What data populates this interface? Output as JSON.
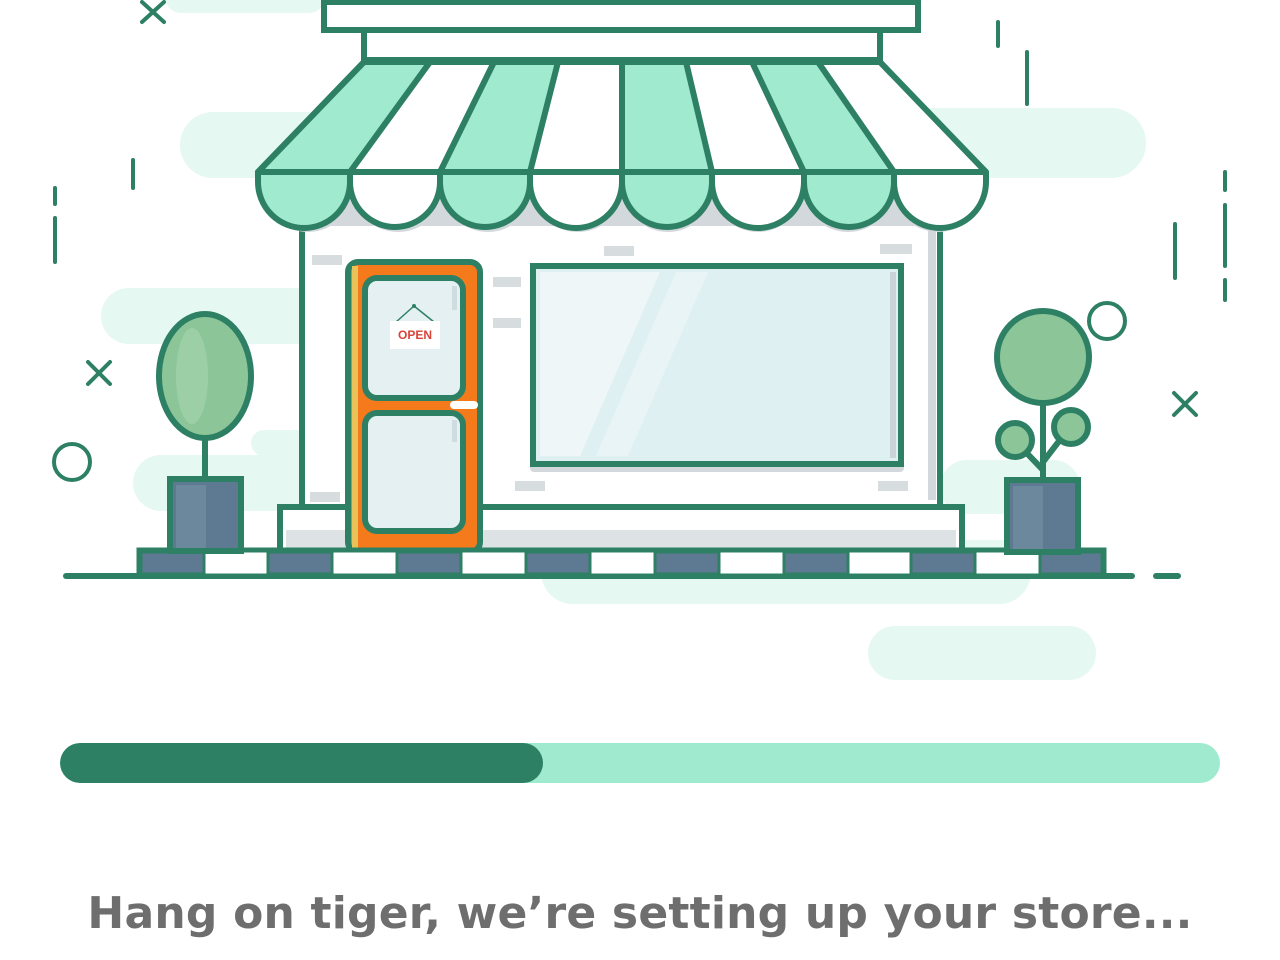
{
  "colors": {
    "primary_dark": "#2e8065",
    "primary_light": "#a0eacf",
    "cloud": "#e5f8f1",
    "door": "#f57a1c",
    "slate": "#5d7a92",
    "foliage": "#8cc597",
    "message_text": "#6e6e6e"
  },
  "illustration": {
    "sign_text": "OPEN",
    "icons": [
      "storefront-illustration",
      "open-sign-icon",
      "potted-plant-icon",
      "cross-sparkle-icon",
      "circle-sparkle-icon"
    ]
  },
  "progress": {
    "value_fraction": 0.416
  },
  "message": "Hang on tiger, we’re setting up your store..."
}
